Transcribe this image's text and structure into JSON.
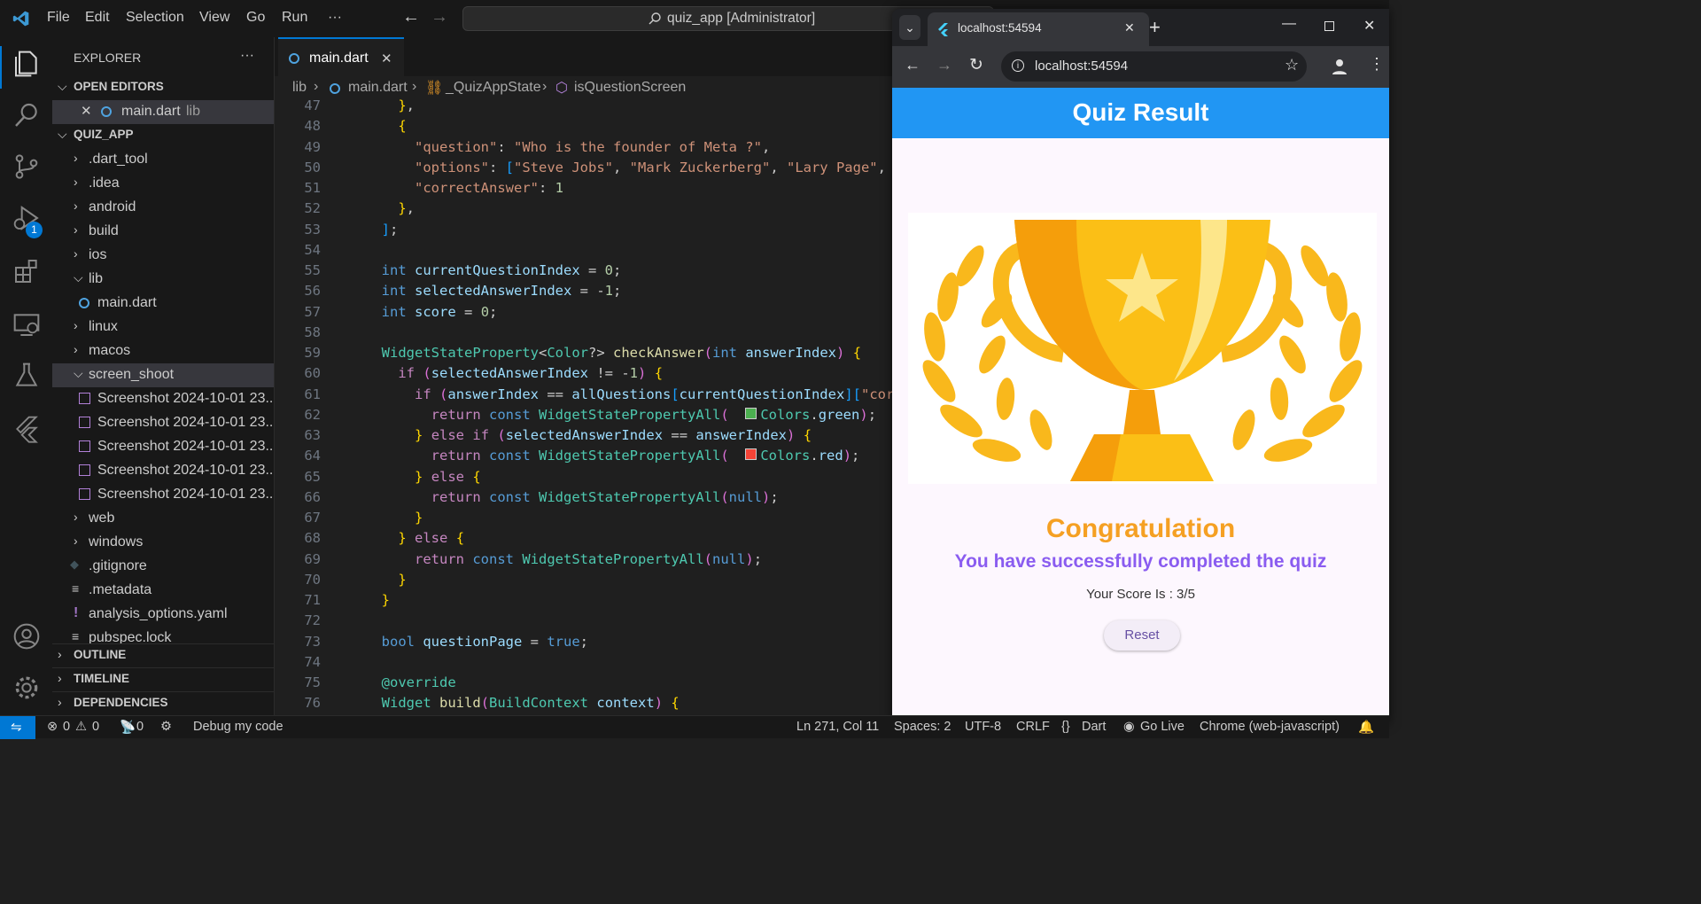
{
  "menu": {
    "file": "File",
    "edit": "Edit",
    "selection": "Selection",
    "view": "View",
    "go": "Go",
    "run": "Run",
    "more": "···"
  },
  "command_center": "quiz_app [Administrator]",
  "sidebar": {
    "title": "EXPLORER",
    "more": "···",
    "open_editors": "OPEN EDITORS",
    "open_file": "main.dart",
    "open_file_dir": "lib",
    "project": "QUIZ_APP",
    "items": [
      ".dart_tool",
      ".idea",
      "android",
      "build",
      "ios",
      "lib",
      "main.dart",
      "linux",
      "macos",
      "screen_shoot",
      "Screenshot 2024-10-01 23...",
      "Screenshot 2024-10-01 23...",
      "Screenshot 2024-10-01 23...",
      "Screenshot 2024-10-01 23...",
      "Screenshot 2024-10-01 23...",
      "web",
      "windows",
      ".gitignore",
      ".metadata",
      "analysis_options.yaml",
      "pubspec.lock"
    ],
    "outline": "OUTLINE",
    "timeline": "TIMELINE",
    "dependencies": "DEPENDENCIES"
  },
  "badge": "1",
  "editor": {
    "tab": "main.dart",
    "close": "✕",
    "breadcrumb": [
      "lib",
      "main.dart",
      "_QuizAppState",
      "isQuestionScreen"
    ]
  },
  "code": [
    {
      "n": "47",
      "t": "    },"
    },
    {
      "n": "48",
      "t": "    {"
    },
    {
      "n": "49",
      "t": "      \"question\": \"Who is the founder of Meta ?\","
    },
    {
      "n": "50",
      "t": "      \"options\": [\"Steve Jobs\", \"Mark Zuckerberg\", \"Lary Page\", \""
    },
    {
      "n": "51",
      "t": "      \"correctAnswer\": 1"
    },
    {
      "n": "52",
      "t": "    },"
    },
    {
      "n": "53",
      "t": "  ];"
    },
    {
      "n": "54",
      "t": ""
    },
    {
      "n": "55",
      "t": "  int currentQuestionIndex = 0;"
    },
    {
      "n": "56",
      "t": "  int selectedAnswerIndex = -1;"
    },
    {
      "n": "57",
      "t": "  int score = 0;"
    },
    {
      "n": "58",
      "t": ""
    },
    {
      "n": "59",
      "t": "  WidgetStateProperty<Color?> checkAnswer(int answerIndex) {"
    },
    {
      "n": "60",
      "t": "    if (selectedAnswerIndex != -1) {"
    },
    {
      "n": "61",
      "t": "      if (answerIndex == allQuestions[currentQuestionIndex][\"corr"
    },
    {
      "n": "62",
      "t": "        return const WidgetStatePropertyAll(  Colors.green);"
    },
    {
      "n": "63",
      "t": "      } else if (selectedAnswerIndex == answerIndex) {"
    },
    {
      "n": "64",
      "t": "        return const WidgetStatePropertyAll(  Colors.red);"
    },
    {
      "n": "65",
      "t": "      } else {"
    },
    {
      "n": "66",
      "t": "        return const WidgetStatePropertyAll(null);"
    },
    {
      "n": "67",
      "t": "      }"
    },
    {
      "n": "68",
      "t": "    } else {"
    },
    {
      "n": "69",
      "t": "      return const WidgetStatePropertyAll(null);"
    },
    {
      "n": "70",
      "t": "    }"
    },
    {
      "n": "71",
      "t": "  }"
    },
    {
      "n": "72",
      "t": ""
    },
    {
      "n": "73",
      "t": "  bool questionPage = true;"
    },
    {
      "n": "74",
      "t": ""
    },
    {
      "n": "75",
      "t": "  @override"
    },
    {
      "n": "76",
      "t": "  Widget build(BuildContext context) {"
    }
  ],
  "browser": {
    "tab_title": "localhost:54594",
    "url": "localhost:54594",
    "app_bar_title": "Quiz Result",
    "congrats": "Congratulation",
    "subtitle": "You have successfully completed the quiz",
    "score": "Your Score Is : 3/5",
    "reset": "Reset"
  },
  "status": {
    "errors": "0",
    "warnings": "0",
    "ports": "0",
    "debug": "Debug my code",
    "position": "Ln 271, Col 11",
    "spaces": "Spaces: 2",
    "encoding": "UTF-8",
    "eol": "CRLF",
    "lang": "Dart",
    "golive": "Go Live",
    "device": "Chrome (web-javascript)"
  },
  "colors": {
    "accent": "#0078d4",
    "appbar": "#2196f3",
    "congrats": "#f5a023",
    "subtitle": "#8a5cf0",
    "page_bg": "#fdf7fe"
  }
}
